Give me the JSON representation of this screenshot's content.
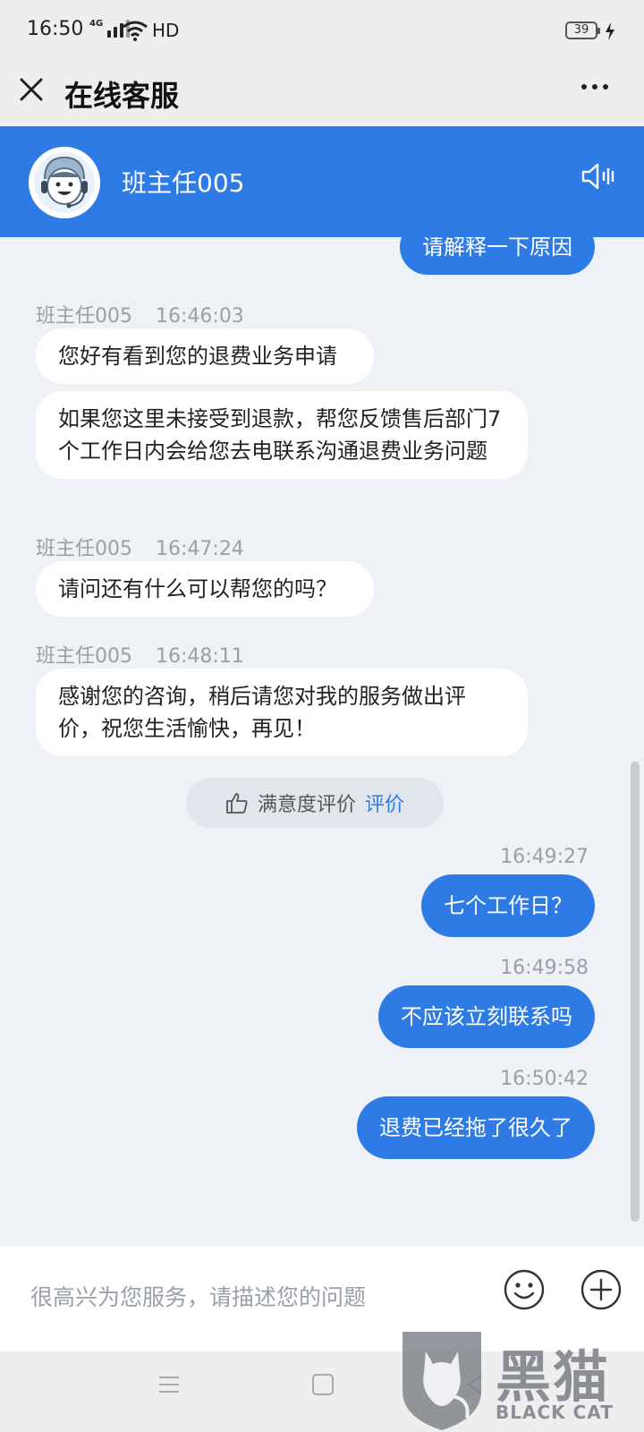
{
  "status_bar": {
    "time": "16:50",
    "network": "4G",
    "hd": "HD",
    "battery": "39"
  },
  "nav": {
    "title": "在线客服"
  },
  "agent": {
    "name": "班主任005"
  },
  "messages": [
    {
      "from": "user",
      "text": "请解释一下原因"
    },
    {
      "from": "agent",
      "sender": "班主任005",
      "time": "16:46:03",
      "bubbles": [
        "您好有看到您的退费业务申请",
        "如果您这里未接受到退款，帮您反馈售后部门7个工作日内会给您去电联系沟通退费业务问题"
      ]
    },
    {
      "from": "agent",
      "sender": "班主任005",
      "time": "16:47:24",
      "bubbles": [
        "请问还有什么可以帮您的吗？"
      ]
    },
    {
      "from": "agent",
      "sender": "班主任005",
      "time": "16:48:11",
      "bubbles": [
        "感谢您的咨询，稍后请您对我的服务做出评价，祝您生活愉快，再见！"
      ]
    },
    {
      "from": "user",
      "time": "16:49:27",
      "text": "七个工作日？"
    },
    {
      "from": "user",
      "time": "16:49:58",
      "text": "不应该立刻联系吗"
    },
    {
      "from": "user",
      "time": "16:50:42",
      "text": "退费已经拖了很久了"
    }
  ],
  "rating": {
    "label": "满意度评价",
    "link": "评价"
  },
  "input": {
    "placeholder": "很高兴为您服务，请描述您的问题"
  },
  "watermark": {
    "cn": "黑猫",
    "en": "BLACK CAT"
  },
  "colors": {
    "accent": "#2e7be5",
    "background": "#eef1f6",
    "bubble_in": "#ffffff",
    "meta_text": "#9aa0a8"
  }
}
